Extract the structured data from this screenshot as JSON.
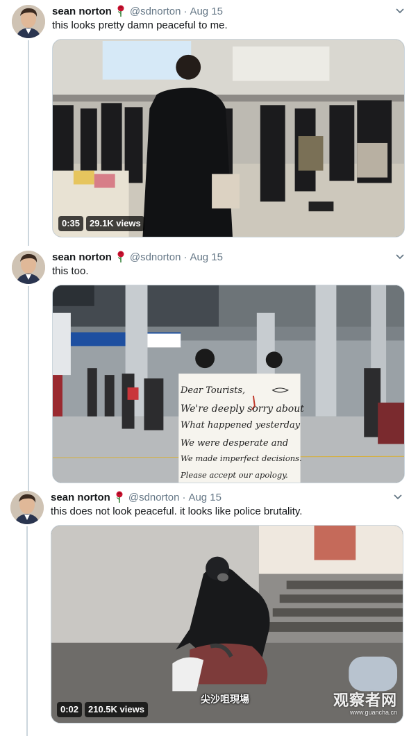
{
  "tweets": [
    {
      "name": "sean norton",
      "handle": "@sdnorton",
      "separator": "·",
      "date": "Aug 15",
      "text": "this looks pretty damn peaceful to me.",
      "media": {
        "kind": "video",
        "duration": "0:35",
        "views": "29.1K views"
      }
    },
    {
      "name": "sean norton",
      "handle": "@sdnorton",
      "separator": "·",
      "date": "Aug 15",
      "text": "this too.",
      "media": {
        "kind": "photo",
        "sign_lines": [
          "Dear Tourists,",
          "We're deeply sorry about",
          "What happened yesterday",
          "We were desperate and",
          "We made imperfect decisions.",
          "Please accept our apology."
        ]
      }
    },
    {
      "name": "sean norton",
      "handle": "@sdnorton",
      "separator": "·",
      "date": "Aug 15",
      "text": "this does not look peaceful. it looks like police brutality.",
      "media": {
        "kind": "video",
        "duration": "0:02",
        "views": "210.5K views",
        "caption": "尖沙咀現場"
      }
    }
  ],
  "watermark": {
    "main": "观察者网",
    "sub": "www.guancha.cn"
  },
  "icons": {
    "rose": "rose-emoji-icon",
    "chevron": "chevron-down-icon"
  },
  "colors": {
    "text": "#14171a",
    "muted": "#657786",
    "border": "#ccd6dd"
  }
}
